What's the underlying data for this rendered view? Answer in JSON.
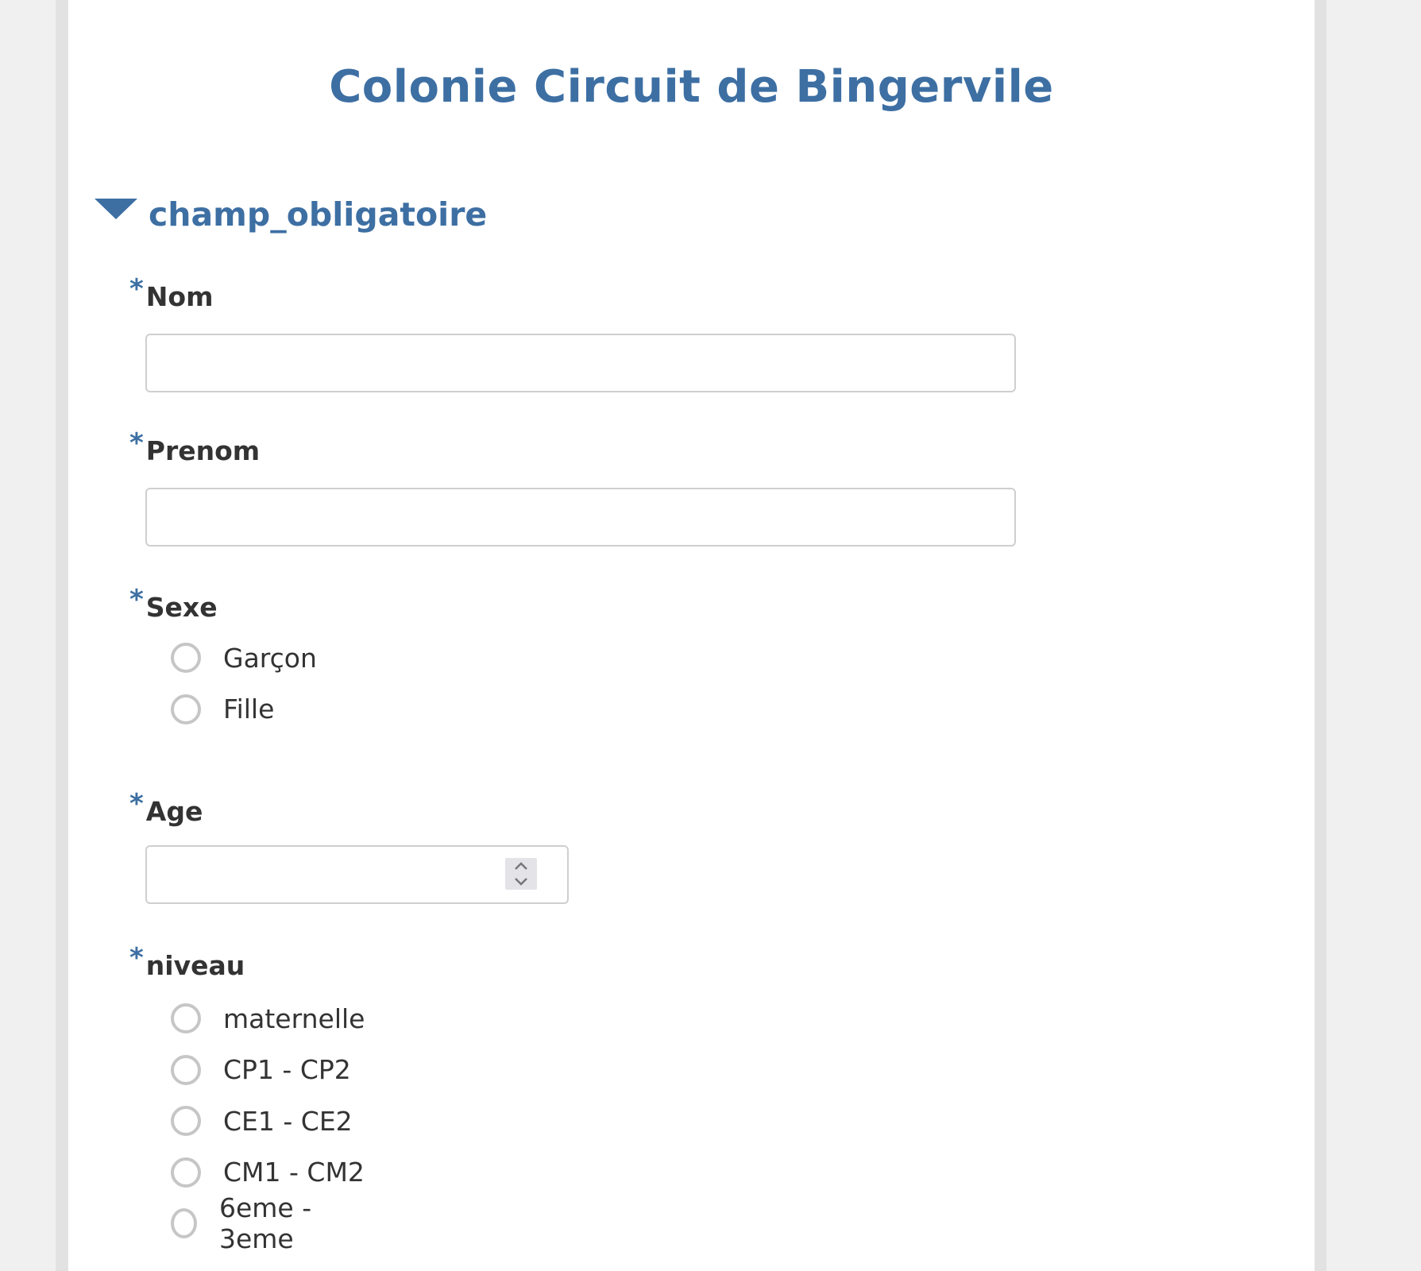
{
  "form": {
    "title": "Colonie Circuit de Bingervile"
  },
  "group": {
    "title": "champ_obligatoire"
  },
  "questions": {
    "nom": {
      "required_mark": "*",
      "label": "Nom",
      "value": ""
    },
    "prenom": {
      "required_mark": "*",
      "label": "Prenom",
      "value": ""
    },
    "sexe": {
      "required_mark": "*",
      "label": "Sexe",
      "options": [
        "Garçon",
        "Fille"
      ]
    },
    "age": {
      "required_mark": "*",
      "label": "Age",
      "value": ""
    },
    "niveau": {
      "required_mark": "*",
      "label": "niveau",
      "options": [
        "maternelle",
        "CP1 - CP2",
        "CE1 - CE2",
        "CM1 - CM2",
        "6eme - 3eme"
      ]
    }
  },
  "colors": {
    "accent": "#3d6fa3",
    "text": "#333333",
    "border": "#cfcfcf",
    "background": "#f0f0f0"
  }
}
